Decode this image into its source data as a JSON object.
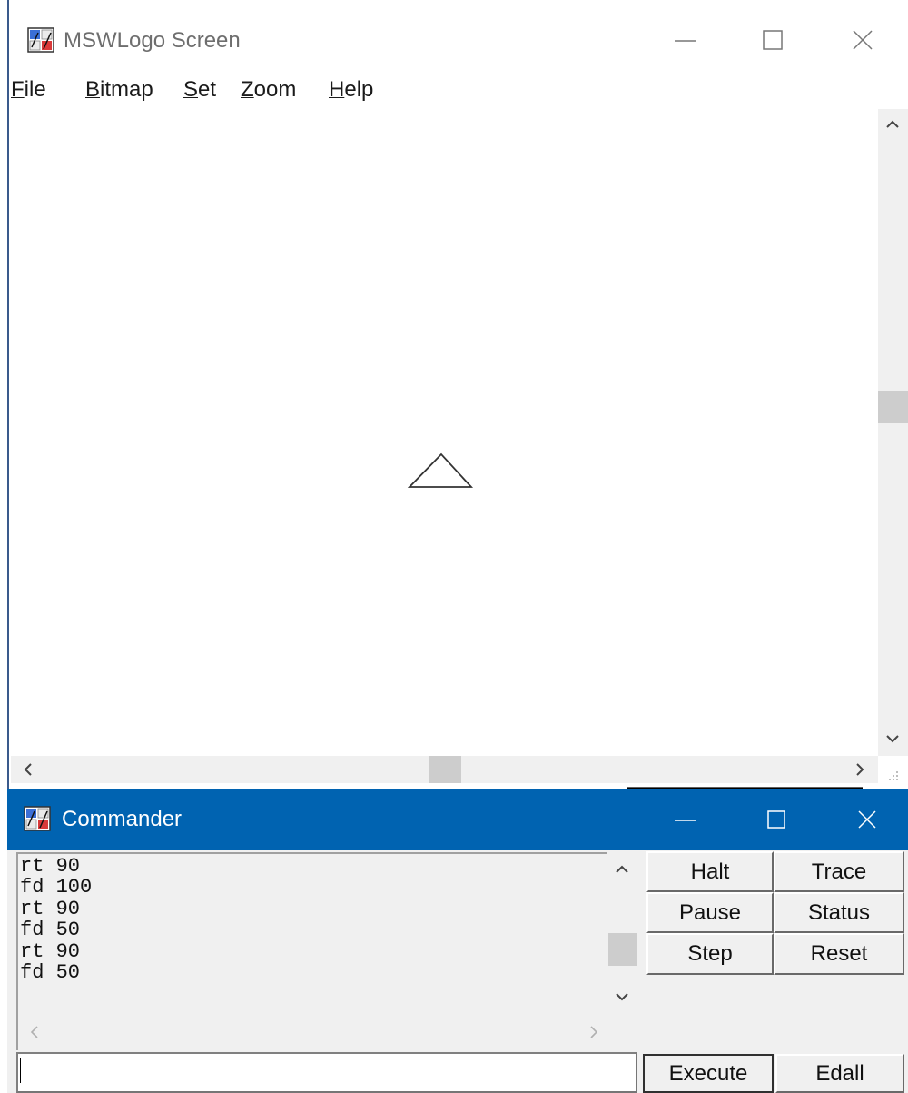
{
  "screen_window": {
    "title": "MSWLogo Screen",
    "menu": [
      {
        "mnemonic": "F",
        "rest": "ile"
      },
      {
        "mnemonic": "B",
        "rest": "itmap"
      },
      {
        "mnemonic": "S",
        "rest": "et"
      },
      {
        "mnemonic": "Z",
        "rest": "oom"
      },
      {
        "mnemonic": "H",
        "rest": "elp"
      }
    ],
    "icons": {
      "app": "mswlogo-app-icon",
      "minimize": "minimize-icon",
      "maximize": "maximize-icon",
      "close": "close-icon"
    }
  },
  "commander": {
    "title": "Commander",
    "history": [
      "rt 90",
      "fd 100",
      "rt 90",
      "fd 50",
      "rt 90",
      "fd 50"
    ],
    "input_value": "",
    "buttons": {
      "halt": "Halt",
      "trace": "Trace",
      "pause": "Pause",
      "status": "Status",
      "step": "Step",
      "reset": "Reset",
      "execute": "Execute",
      "edall": "Edall"
    }
  },
  "colors": {
    "commander_titlebar": "#0063b1",
    "face": "#f0f0f0"
  }
}
